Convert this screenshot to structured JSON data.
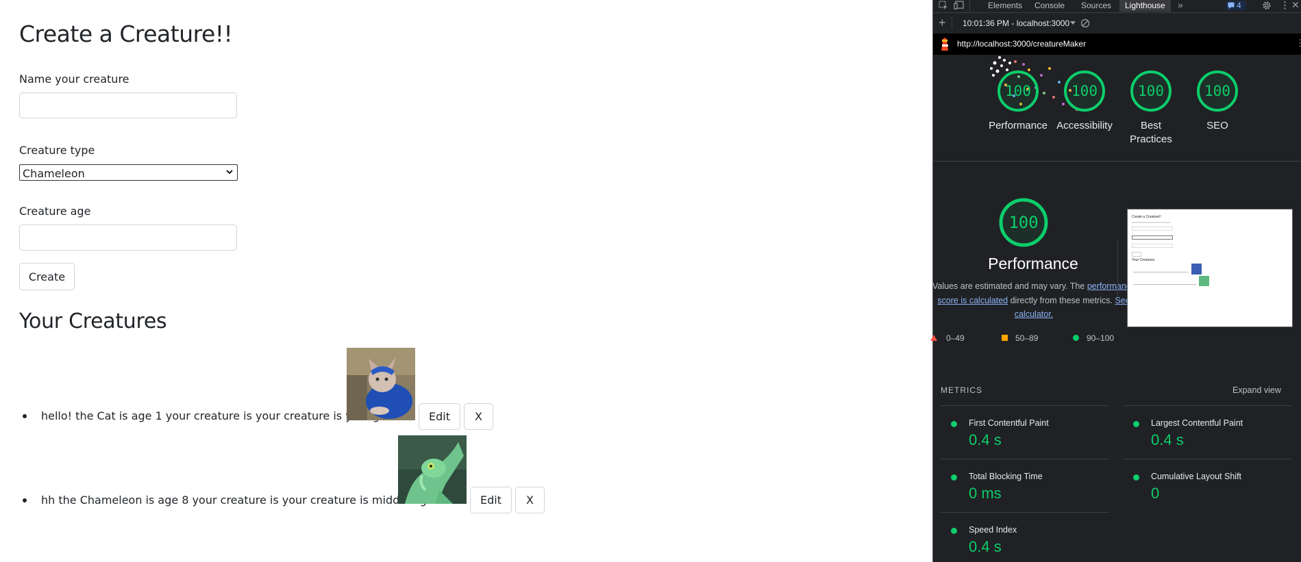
{
  "app": {
    "title": "Create a Creature!!",
    "name_label": "Name your creature",
    "name_value": "",
    "type_label": "Creature type",
    "type_selected": "Chameleon",
    "age_label": "Creature age",
    "age_value": "",
    "create_button": "Create",
    "list_title": "Your Creatures",
    "creatures": [
      {
        "text": "hello! the Cat is age 1 your creature is your creature is young!!!",
        "edit": "Edit",
        "delete": "X",
        "image": "cat-photo"
      },
      {
        "text": "hh the Chameleon is age 8 your creature is your creature is middle aged!!",
        "edit": "Edit",
        "delete": "X",
        "image": "chameleon-photo"
      }
    ]
  },
  "devtools": {
    "tabs": [
      "Elements",
      "Console",
      "Sources",
      "Lighthouse"
    ],
    "active_tab": "Lighthouse",
    "issues_count": "4",
    "report_time": "10:01:36 PM - localhost:3000",
    "url": "http://localhost:3000/creatureMaker",
    "scores": [
      {
        "label": "Performance",
        "value": "100"
      },
      {
        "label": "Accessibility",
        "value": "100"
      },
      {
        "label": "Best Practices",
        "value": "100"
      },
      {
        "label": "SEO",
        "value": "100"
      }
    ],
    "main_score": "100",
    "main_title": "Performance",
    "desc_1": "Values are estimated and may vary. The",
    "desc_link": "performance score is calculated",
    "desc_2": "directly from these metrics.",
    "desc_link_2": "See calculator.",
    "legend": [
      "0–49",
      "50–89",
      "90–100"
    ],
    "metrics_header": "METRICS",
    "expand_label": "Expand view",
    "metrics": [
      {
        "name": "First Contentful Paint",
        "value": "0.4 s"
      },
      {
        "name": "Largest Contentful Paint",
        "value": "0.4 s"
      },
      {
        "name": "Total Blocking Time",
        "value": "0 ms"
      },
      {
        "name": "Cumulative Layout Shift",
        "value": "0"
      },
      {
        "name": "Speed Index",
        "value": "0.4 s"
      }
    ],
    "colors": {
      "pass": "#0cce6b",
      "average": "#ffa400",
      "fail": "#ff4e42"
    }
  }
}
